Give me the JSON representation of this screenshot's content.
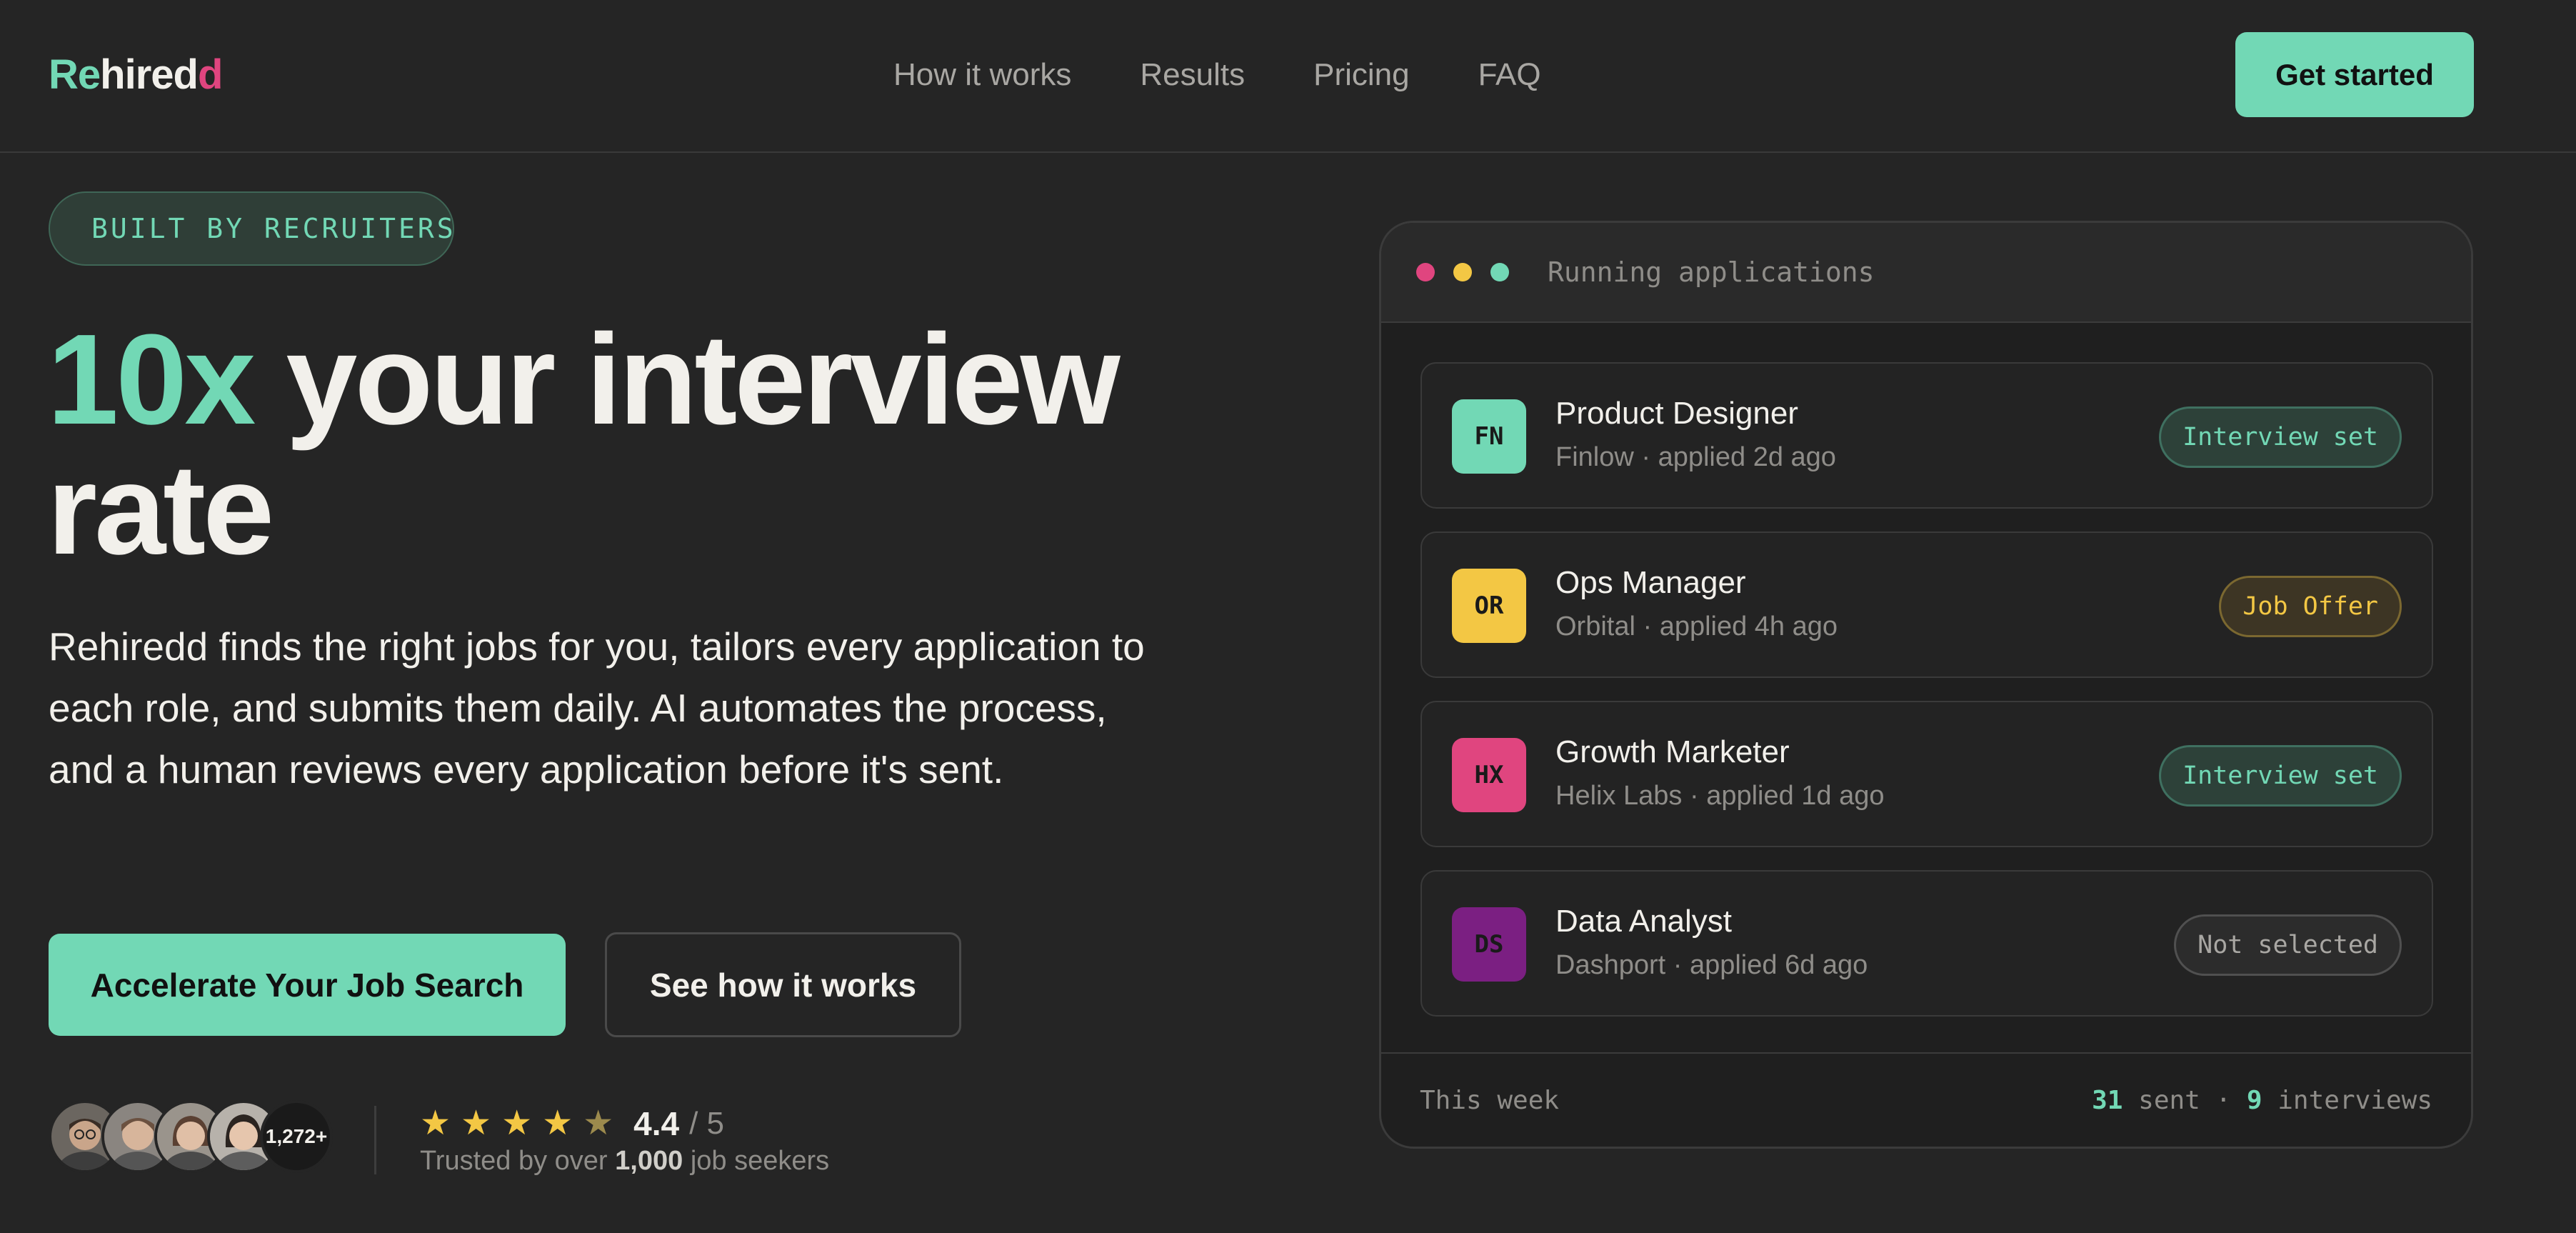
{
  "brand": {
    "logo_part1": "Re",
    "logo_part2": "hired",
    "logo_part3": "d"
  },
  "nav": {
    "items": [
      "How it works",
      "Results",
      "Pricing",
      "FAQ"
    ],
    "cta": "Get started"
  },
  "hero": {
    "badge": "BUILT BY RECRUITERS",
    "headline_highlight": "10x",
    "headline_rest_line1": " your interview",
    "headline_line2": "rate",
    "description": "Rehiredd finds the right jobs for you, tailors every application to each role, and submits them daily. AI automates the process, and a human reviews every application before it's sent.",
    "primary_cta": "Accelerate Your Job Search",
    "secondary_cta": "See how it works"
  },
  "social_proof": {
    "avatar_count": "1,272+",
    "rating": "4.4",
    "rating_scale": "/ 5",
    "stars_value": 4.4,
    "trusted_prefix": "Trusted by over",
    "trusted_count": "1,000",
    "trusted_suffix": "job seekers"
  },
  "card": {
    "title": "Running applications",
    "jobs": [
      {
        "initials": "FN",
        "title": "Product Designer",
        "meta": "Finlow · applied 2d ago",
        "status": "Interview set",
        "tile_color": "#72d8b5"
      },
      {
        "initials": "OR",
        "title": "Ops Manager",
        "meta": "Orbital · applied 4h ago",
        "status": "Job Offer",
        "tile_color": "#f3c744"
      },
      {
        "initials": "HX",
        "title": "Growth Marketer",
        "meta": "Helix Labs · applied 1d ago",
        "status": "Interview set",
        "tile_color": "#e0457f"
      },
      {
        "initials": "DS",
        "title": "Data Analyst",
        "meta": "Dashport · applied 6d ago",
        "status": "Not selected",
        "tile_color": "#7b1f82"
      }
    ],
    "footer_label": "This week",
    "sent_count": "31",
    "sent_label": "sent ·",
    "interviews_count": "9",
    "interviews_label": "interviews"
  },
  "colors": {
    "accent": "#72d8b5",
    "background": "#252525",
    "pink": "#e0457f",
    "yellow": "#f3c744"
  }
}
